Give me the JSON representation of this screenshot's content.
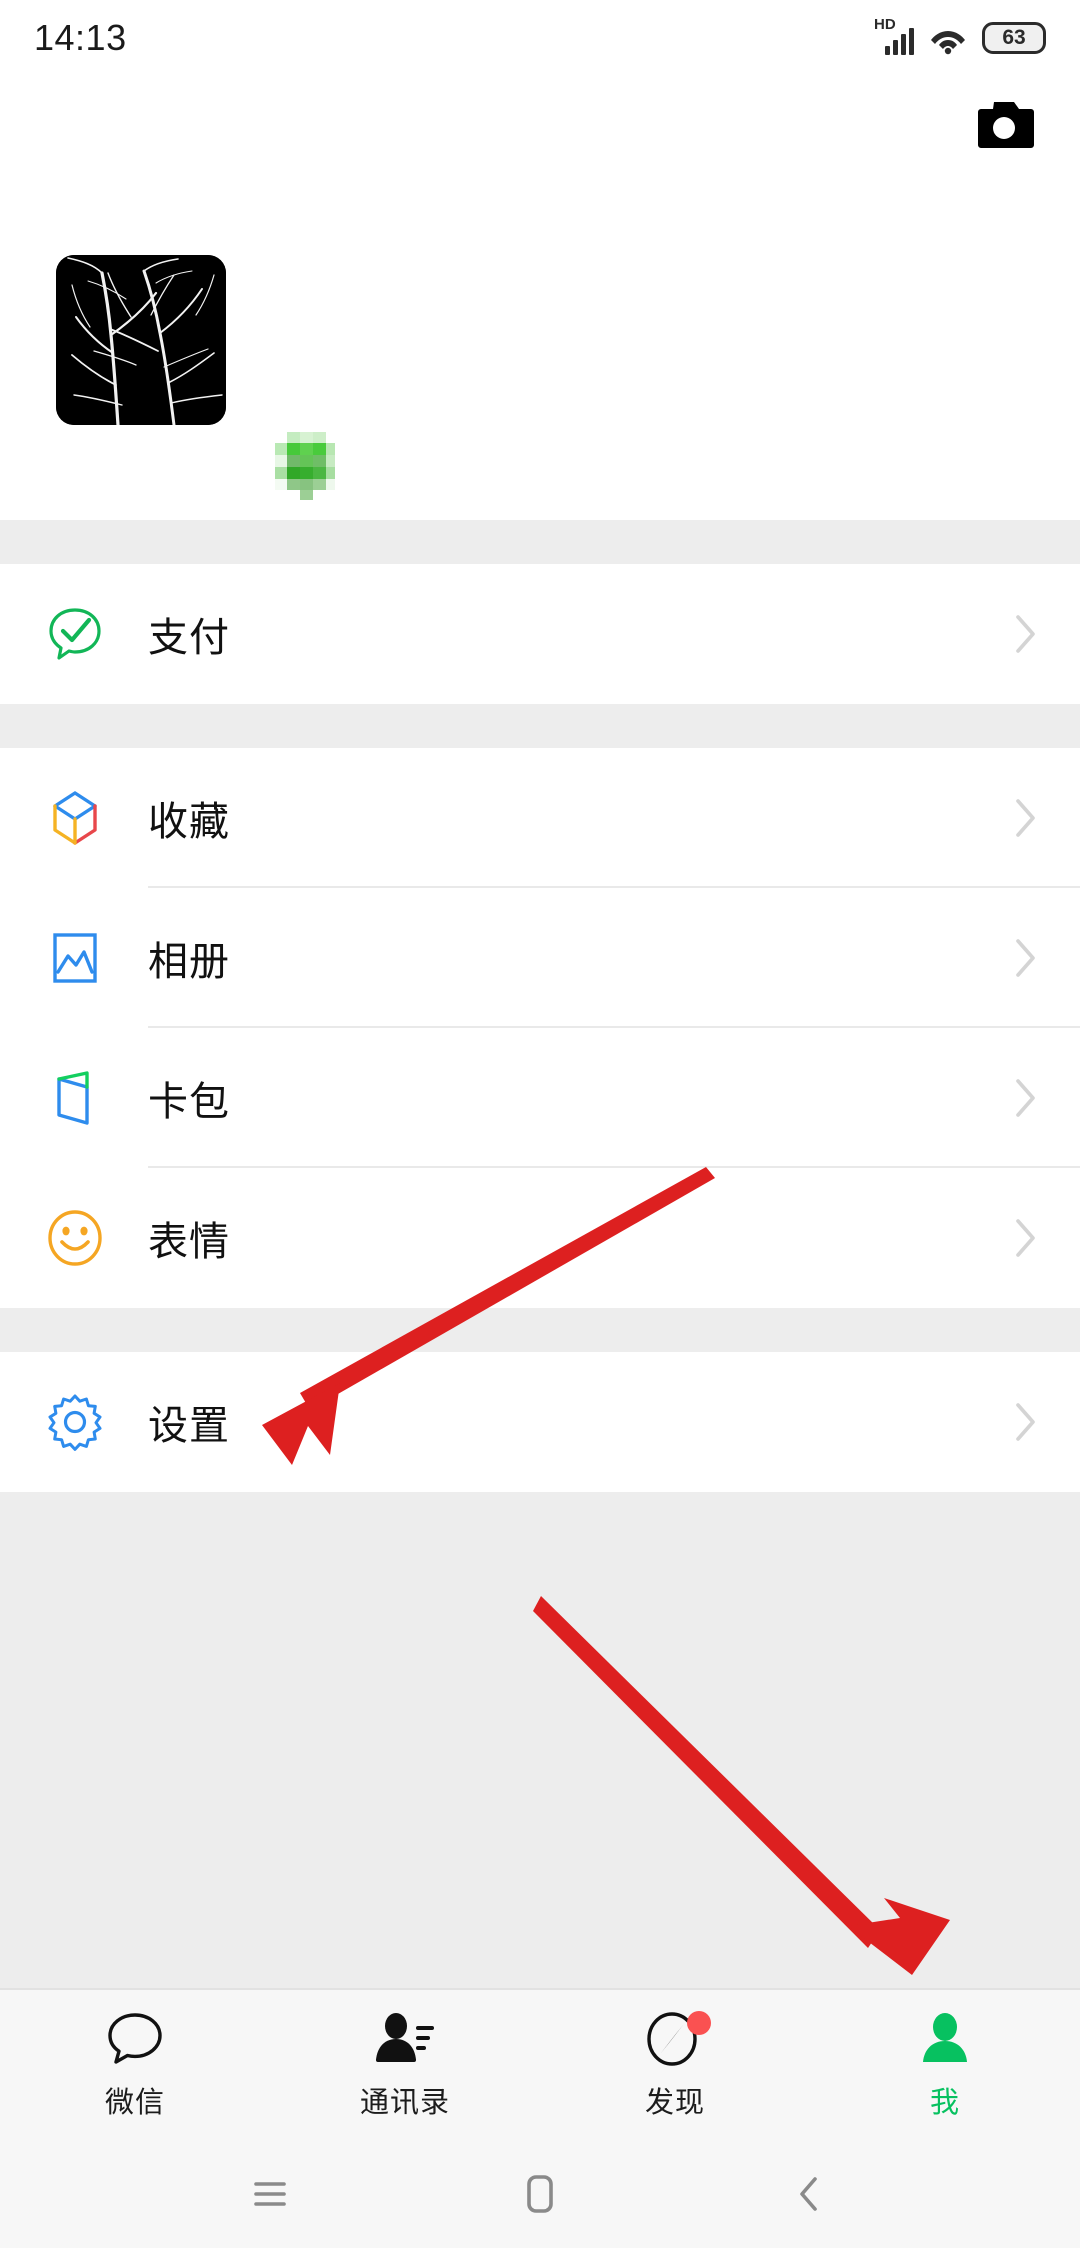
{
  "status_bar": {
    "time": "14:13",
    "network_label": "HD",
    "battery_level": "63",
    "icons": [
      "hd-signal-icon",
      "wifi-icon",
      "battery-icon"
    ]
  },
  "header": {
    "camera_icon": "camera-icon"
  },
  "profile": {
    "avatar_alt": "tree-branches-photo",
    "nickname": "",
    "nickname_redacted": true,
    "wechat_id": "",
    "wechat_id_redacted": true,
    "qr_icon": "qr-code-icon",
    "chevron": "chevron-right-icon"
  },
  "sections": [
    {
      "items": [
        {
          "label": "支付",
          "icon": "pay-icon",
          "color": "#12b657"
        }
      ]
    },
    {
      "items": [
        {
          "label": "收藏",
          "icon": "favorites-cube-icon",
          "color": "#2e8ced"
        },
        {
          "label": "相册",
          "icon": "album-photo-icon",
          "color": "#2e8ced"
        },
        {
          "label": "卡包",
          "icon": "cards-wallet-icon",
          "color": "#2e8ced"
        },
        {
          "label": "表情",
          "icon": "sticker-smiley-icon",
          "color": "#f5a623"
        }
      ]
    },
    {
      "items": [
        {
          "label": "设置",
          "icon": "settings-gear-icon",
          "color": "#2e8ced"
        }
      ]
    }
  ],
  "tabbar": {
    "tabs": [
      {
        "label": "微信",
        "icon": "chat-bubble-icon",
        "active": false,
        "badge": false
      },
      {
        "label": "通讯录",
        "icon": "contacts-icon",
        "active": false,
        "badge": false
      },
      {
        "label": "发现",
        "icon": "discover-compass-icon",
        "active": false,
        "badge": true
      },
      {
        "label": "我",
        "icon": "me-person-icon",
        "active": true,
        "badge": false
      }
    ],
    "active_color": "#07c160",
    "badge_color": "#fa5151"
  },
  "system_nav": {
    "buttons": [
      {
        "icon": "recents-menu-icon"
      },
      {
        "icon": "home-square-icon"
      },
      {
        "icon": "back-chevron-icon"
      }
    ]
  },
  "annotations": {
    "color": "#dd2020",
    "arrows": [
      {
        "name": "arrow-to-settings",
        "target": "设置"
      },
      {
        "name": "arrow-to-me-tab",
        "target": "我"
      }
    ]
  }
}
